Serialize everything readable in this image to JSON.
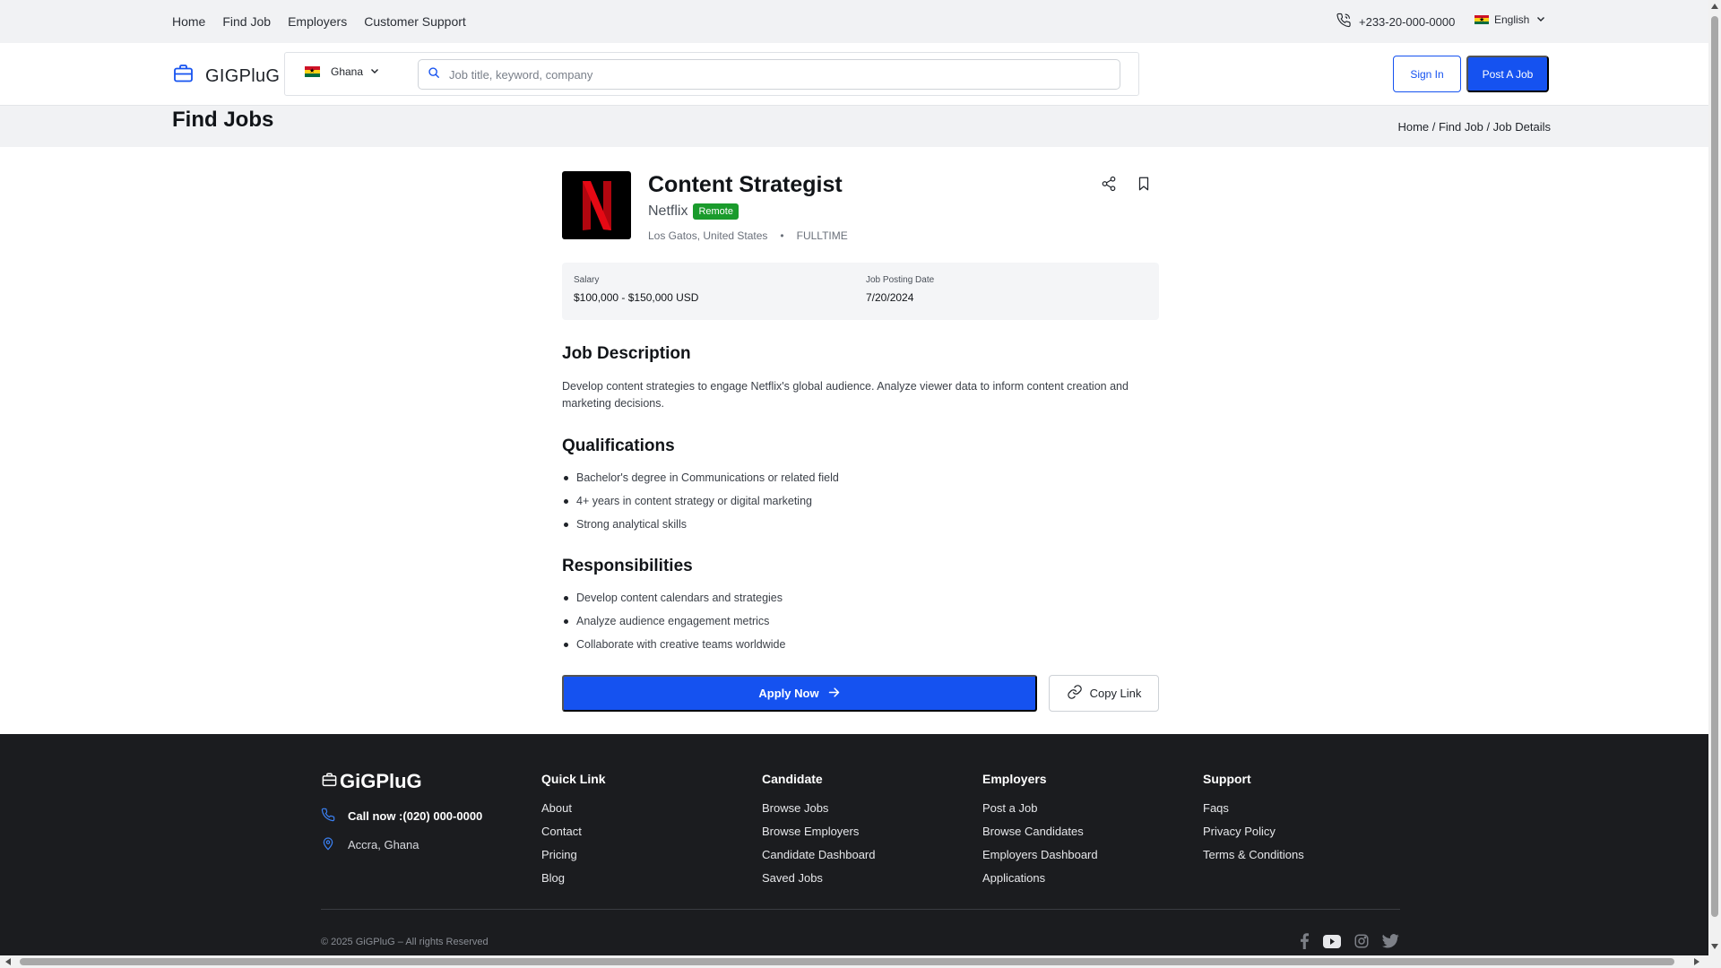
{
  "topbar": {
    "nav": [
      "Home",
      "Find Job",
      "Employers",
      "Customer Support"
    ],
    "phone": "+233-20-000-0000",
    "language": "English"
  },
  "header": {
    "brand": "GIGPluG",
    "country": "Ghana",
    "search_placeholder": "Job title, keyword, company",
    "signin_label": "Sign In",
    "post_job_label": "Post A Job"
  },
  "page": {
    "title": "Find Jobs",
    "breadcrumb": "Home / Find Job / Job Details"
  },
  "job": {
    "title": "Content Strategist",
    "company": "Netflix",
    "logo_letter": "N",
    "work_mode": "Remote",
    "location": "Los Gatos, United States",
    "job_type": "FULLTIME",
    "salary_label": "Salary",
    "salary": "$100,000 - $150,000 USD",
    "posting_date_label": "Job Posting Date",
    "posting_date": "7/20/2024",
    "description_heading": "Job Description",
    "description": "Develop content strategies to engage Netflix's global audience. Analyze viewer data to inform content creation and marketing decisions.",
    "qualifications_heading": "Qualifications",
    "qualifications": [
      "Bachelor's degree in Communications or related field",
      "4+ years in content strategy or digital marketing",
      "Strong analytical skills"
    ],
    "responsibilities_heading": "Responsibilities",
    "responsibilities": [
      "Develop content calendars and strategies",
      "Analyze audience engagement metrics",
      "Collaborate with creative teams worldwide"
    ],
    "apply_label": "Apply Now",
    "copy_link_label": "Copy Link"
  },
  "footer": {
    "brand": "GiGPluG",
    "call": "Call now :(020) 000-0000",
    "address": "Accra, Ghana",
    "columns": [
      {
        "heading": "Quick Link",
        "links": [
          "About",
          "Contact",
          "Pricing",
          "Blog"
        ]
      },
      {
        "heading": "Candidate",
        "links": [
          "Browse Jobs",
          "Browse Employers",
          "Candidate Dashboard",
          "Saved Jobs"
        ]
      },
      {
        "heading": "Employers",
        "links": [
          "Post a Job",
          "Browse Candidates",
          "Employers Dashboard",
          "Applications"
        ]
      },
      {
        "heading": "Support",
        "links": [
          "Faqs",
          "Privacy Policy",
          "Terms & Conditions"
        ]
      }
    ],
    "copyright": "© 2025 GiGPluG – All rights Reserved",
    "socials": [
      "facebook-icon",
      "youtube-icon",
      "instagram-icon",
      "twitter-icon"
    ]
  },
  "colors": {
    "primary": "#1552f0",
    "remote_badge": "#1a9b2c",
    "footer_bg": "#1b1c1f",
    "netflix_red": "#e50914"
  }
}
